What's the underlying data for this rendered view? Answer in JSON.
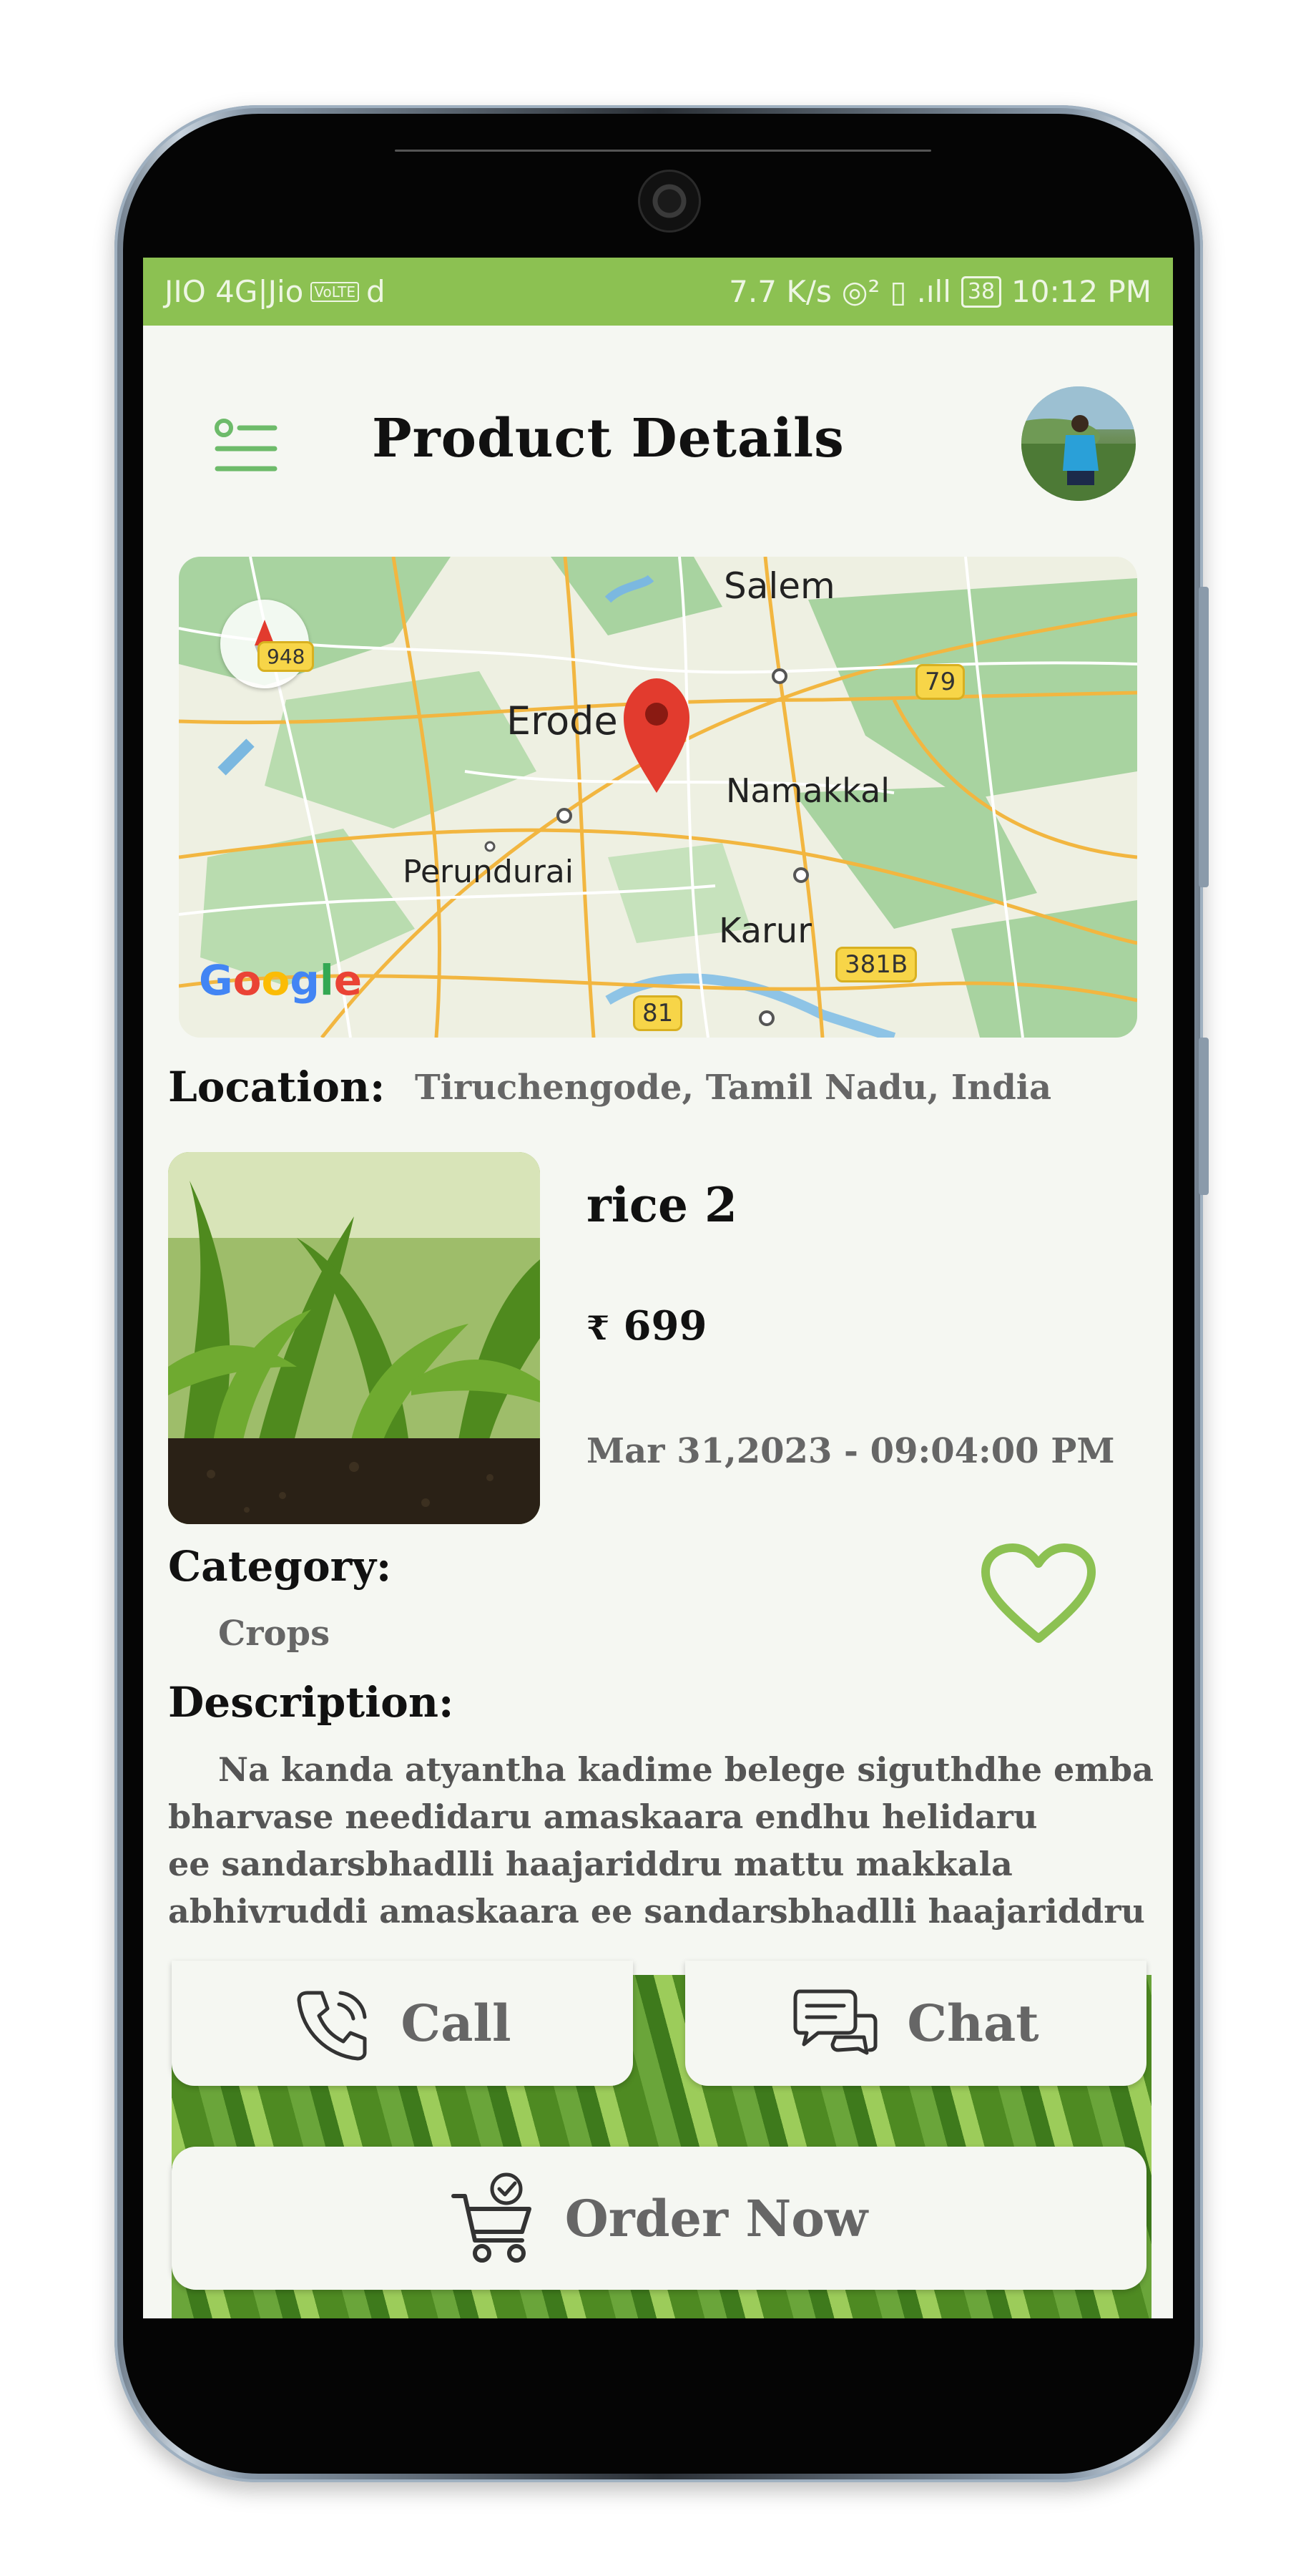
{
  "status_bar": {
    "carrier": "JIO 4G|Jio",
    "volte": "VoLTE",
    "speed": "7.7 K/s",
    "battery": "38",
    "time": "10:12 PM",
    "color": "#8cc152"
  },
  "header": {
    "title": "Product Details",
    "menu_icon": "menu-icon",
    "avatar_icon": "user-avatar"
  },
  "map": {
    "places": [
      "Salem",
      "Erode",
      "Namakkal",
      "Perundurai",
      "Karur"
    ],
    "road_numbers": [
      "79",
      "381B",
      "81",
      "948"
    ],
    "attribution": "Google"
  },
  "location": {
    "label": "Location:",
    "value": "Tiruchengode, Tamil Nadu, India"
  },
  "product": {
    "name": "rice 2",
    "currency": "₹",
    "price": "699",
    "date": "Mar 31,2023 - 09:04:00 PM"
  },
  "category": {
    "label": "Category:",
    "value": "Crops"
  },
  "description": {
    "label": "Description:",
    "lines": [
      "Na kanda atyantha kadime belege siguthdhe emba",
      "bharvase needidaru amaskaara endhu helidaru",
      "ee sandarsbhadlli haajariddru mattu makkala",
      "abhivruddi amaskaara ee sandarsbhadlli haajariddru"
    ]
  },
  "actions": {
    "call": "Call",
    "chat": "Chat",
    "order": "Order Now"
  },
  "colors": {
    "accent": "#8cc152",
    "background": "#f5f7f2",
    "muted_text": "#666666"
  }
}
